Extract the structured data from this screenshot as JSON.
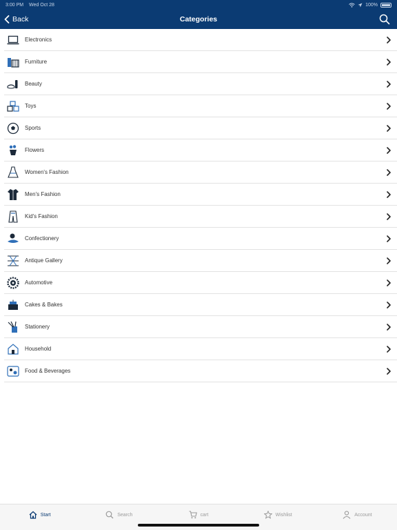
{
  "status": {
    "time": "3:00 PM",
    "date": "Wed Oct 28",
    "battery": "100%"
  },
  "header": {
    "back_label": "Back",
    "title": "Categories"
  },
  "categories": [
    {
      "label": "Electronics",
      "icon": "laptop-icon"
    },
    {
      "label": "Furniture",
      "icon": "furniture-icon"
    },
    {
      "label": "Beauty",
      "icon": "beauty-icon"
    },
    {
      "label": "Toys",
      "icon": "toy-blocks-icon"
    },
    {
      "label": "Sports",
      "icon": "soccer-ball-icon"
    },
    {
      "label": "Flowers",
      "icon": "flowers-icon"
    },
    {
      "label": "Women's Fashion",
      "icon": "dress-icon"
    },
    {
      "label": "Men's Fashion",
      "icon": "shirt-icon"
    },
    {
      "label": "Kid's Fashion",
      "icon": "kids-clothes-icon"
    },
    {
      "label": "Confectionery",
      "icon": "candy-icon"
    },
    {
      "label": "Antique Gallery",
      "icon": "antique-icon"
    },
    {
      "label": "Automotive",
      "icon": "gear-wheel-icon"
    },
    {
      "label": "Cakes & Bakes",
      "icon": "cake-icon"
    },
    {
      "label": "Stationery",
      "icon": "pencil-cup-icon"
    },
    {
      "label": "Household",
      "icon": "house-icon"
    },
    {
      "label": "Food & Beverages",
      "icon": "food-icon"
    }
  ],
  "tabs": [
    {
      "label": "Start",
      "icon": "home-icon",
      "active": true
    },
    {
      "label": "Search",
      "icon": "search-icon",
      "active": false
    },
    {
      "label": "cart",
      "icon": "cart-icon",
      "active": false
    },
    {
      "label": "Wishlist",
      "icon": "star-icon",
      "active": false
    },
    {
      "label": "Account",
      "icon": "person-icon",
      "active": false
    }
  ],
  "colors": {
    "brand": "#0b3b73",
    "accent": "#2f6fb8",
    "icon_dark": "#1c2a3a",
    "tab_inactive": "#9a9a9a"
  }
}
